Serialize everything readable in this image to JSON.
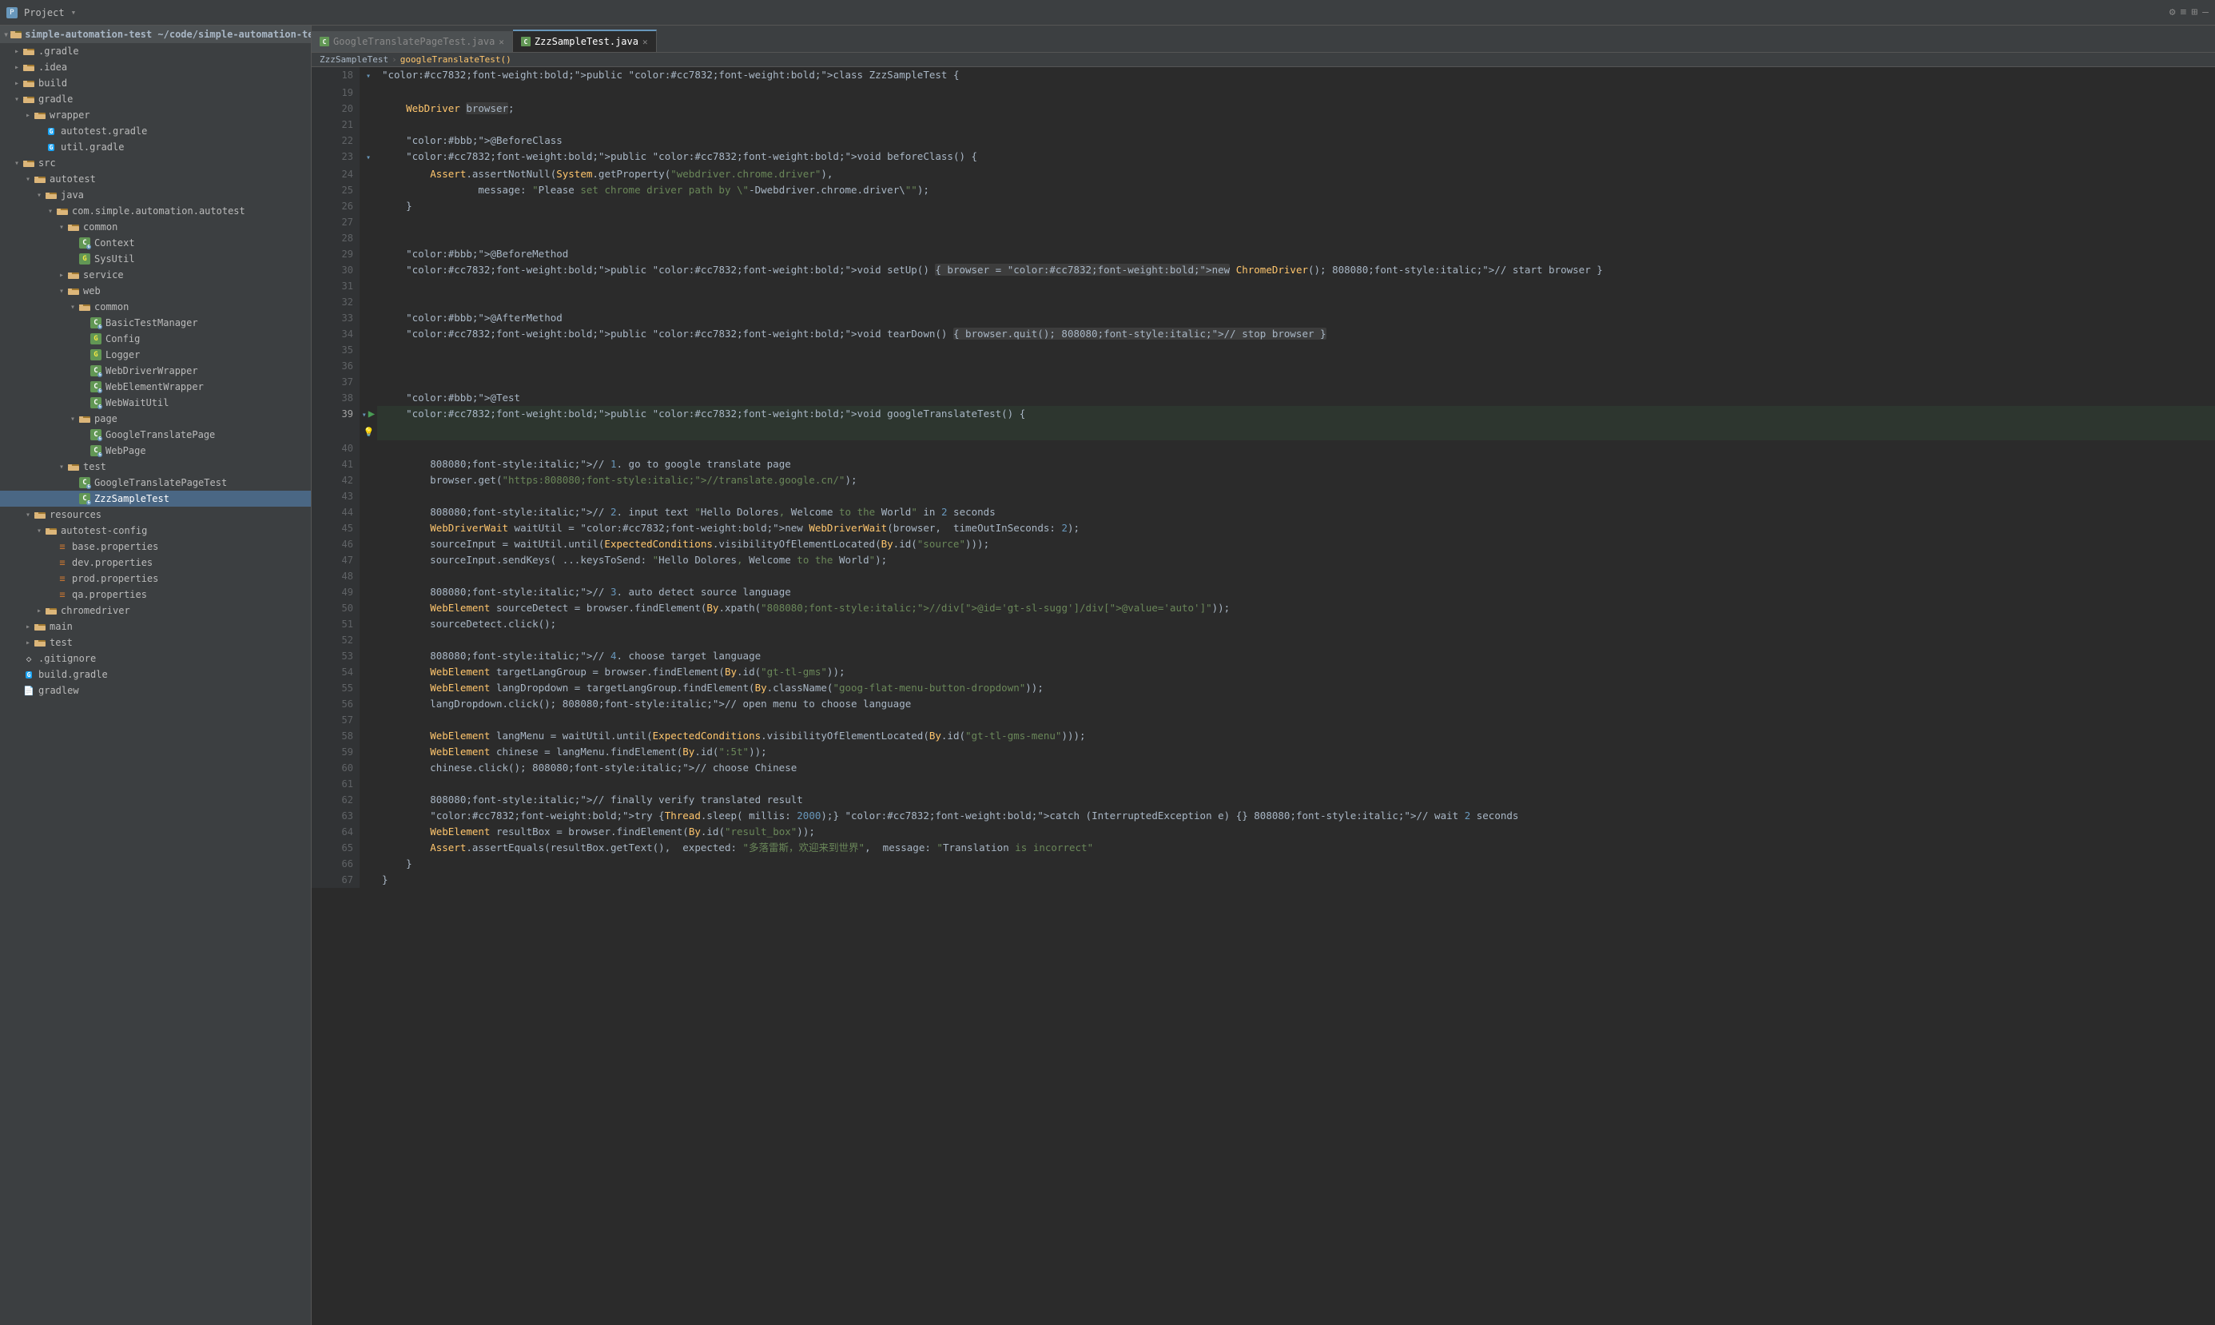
{
  "topbar": {
    "title": "Project",
    "dropdown_arrow": "▾"
  },
  "sidebar": {
    "header": "Project",
    "root": "simple-automation-test ~/code/simple-automation-te...",
    "items": [
      {
        "id": "gradle-folder",
        "label": ".gradle",
        "indent": 1,
        "type": "folder",
        "expanded": false
      },
      {
        "id": "idea-folder",
        "label": ".idea",
        "indent": 1,
        "type": "folder",
        "expanded": false
      },
      {
        "id": "build-folder",
        "label": "build",
        "indent": 1,
        "type": "folder",
        "expanded": false
      },
      {
        "id": "gradle-folder2",
        "label": "gradle",
        "indent": 1,
        "type": "folder",
        "expanded": true
      },
      {
        "id": "wrapper-folder",
        "label": "wrapper",
        "indent": 2,
        "type": "folder",
        "expanded": false
      },
      {
        "id": "autotest-gradle",
        "label": "autotest.gradle",
        "indent": 3,
        "type": "gradle"
      },
      {
        "id": "util-gradle",
        "label": "util.gradle",
        "indent": 3,
        "type": "gradle"
      },
      {
        "id": "src-folder",
        "label": "src",
        "indent": 1,
        "type": "folder",
        "expanded": true
      },
      {
        "id": "autotest-folder",
        "label": "autotest",
        "indent": 2,
        "type": "folder",
        "expanded": true
      },
      {
        "id": "java-folder",
        "label": "java",
        "indent": 3,
        "type": "folder",
        "expanded": true
      },
      {
        "id": "com-folder",
        "label": "com.simple.automation.autotest",
        "indent": 4,
        "type": "folder",
        "expanded": true
      },
      {
        "id": "common-folder",
        "label": "common",
        "indent": 5,
        "type": "folder",
        "expanded": true
      },
      {
        "id": "context-file",
        "label": "Context",
        "indent": 6,
        "type": "java-c"
      },
      {
        "id": "sysutil-file",
        "label": "SysUtil",
        "indent": 6,
        "type": "java-g"
      },
      {
        "id": "service-folder",
        "label": "service",
        "indent": 5,
        "type": "folder",
        "expanded": false
      },
      {
        "id": "web-folder",
        "label": "web",
        "indent": 5,
        "type": "folder",
        "expanded": true
      },
      {
        "id": "common-folder2",
        "label": "common",
        "indent": 6,
        "type": "folder",
        "expanded": true
      },
      {
        "id": "basictestmanager",
        "label": "BasicTestManager",
        "indent": 7,
        "type": "java-c"
      },
      {
        "id": "config-file",
        "label": "Config",
        "indent": 7,
        "type": "java-g"
      },
      {
        "id": "logger-file",
        "label": "Logger",
        "indent": 7,
        "type": "java-g"
      },
      {
        "id": "webdriverwrapper",
        "label": "WebDriverWrapper",
        "indent": 7,
        "type": "java-c"
      },
      {
        "id": "webelementwrapper",
        "label": "WebElementWrapper",
        "indent": 7,
        "type": "java-c"
      },
      {
        "id": "webwaitutil",
        "label": "WebWaitUtil",
        "indent": 7,
        "type": "java-c"
      },
      {
        "id": "page-folder",
        "label": "page",
        "indent": 6,
        "type": "folder",
        "expanded": true
      },
      {
        "id": "googletranslatepage",
        "label": "GoogleTranslatePage",
        "indent": 7,
        "type": "java-c"
      },
      {
        "id": "webpage-file",
        "label": "WebPage",
        "indent": 7,
        "type": "java-c"
      },
      {
        "id": "test-folder",
        "label": "test",
        "indent": 5,
        "type": "folder",
        "expanded": true
      },
      {
        "id": "googletranslatetest-file",
        "label": "GoogleTranslatePageTest",
        "indent": 6,
        "type": "java-c"
      },
      {
        "id": "zzzsampletest-file",
        "label": "ZzzSampleTest",
        "indent": 6,
        "type": "java-c",
        "selected": true
      },
      {
        "id": "resources-folder",
        "label": "resources",
        "indent": 2,
        "type": "folder",
        "expanded": true
      },
      {
        "id": "autotest-config-folder",
        "label": "autotest-config",
        "indent": 3,
        "type": "folder",
        "expanded": true
      },
      {
        "id": "base-properties",
        "label": "base.properties",
        "indent": 4,
        "type": "properties"
      },
      {
        "id": "dev-properties",
        "label": "dev.properties",
        "indent": 4,
        "type": "properties"
      },
      {
        "id": "prod-properties",
        "label": "prod.properties",
        "indent": 4,
        "type": "properties"
      },
      {
        "id": "qa-properties",
        "label": "qa.properties",
        "indent": 4,
        "type": "properties"
      },
      {
        "id": "chromedriver-folder",
        "label": "chromedriver",
        "indent": 3,
        "type": "folder",
        "expanded": false
      },
      {
        "id": "main-folder",
        "label": "main",
        "indent": 2,
        "type": "folder",
        "expanded": false
      },
      {
        "id": "test-folder2",
        "label": "test",
        "indent": 2,
        "type": "folder",
        "expanded": false
      },
      {
        "id": "gitignore",
        "label": ".gitignore",
        "indent": 1,
        "type": "git"
      },
      {
        "id": "build-gradle",
        "label": "build.gradle",
        "indent": 1,
        "type": "gradle"
      },
      {
        "id": "gradlew",
        "label": "gradlew",
        "indent": 1,
        "type": "file"
      }
    ]
  },
  "editor": {
    "tabs": [
      {
        "id": "tab-googletranslate",
        "label": "GoogleTranslatePageTest.java",
        "active": false
      },
      {
        "id": "tab-zzzsample",
        "label": "ZzzSampleTest.java",
        "active": true
      }
    ],
    "breadcrumb": [
      "ZzzSampleTest",
      "googleTranslateTest()"
    ],
    "lines": [
      {
        "num": 18,
        "code": "public class ZzzSampleTest {",
        "dec": "fold"
      },
      {
        "num": 19,
        "code": ""
      },
      {
        "num": 20,
        "code": "    WebDriver browser;"
      },
      {
        "num": 21,
        "code": ""
      },
      {
        "num": 22,
        "code": "    @BeforeClass"
      },
      {
        "num": 23,
        "code": "    public void beforeClass() {",
        "dec": "fold"
      },
      {
        "num": 24,
        "code": "        Assert.assertNotNull(System.getProperty(\"webdriver.chrome.driver\"),"
      },
      {
        "num": 25,
        "code": "                message: \"Please set chrome driver path by \\\"-Dwebdriver.chrome.driver\\\"\");"
      },
      {
        "num": 26,
        "code": "    }"
      },
      {
        "num": 27,
        "code": ""
      },
      {
        "num": 28,
        "code": ""
      },
      {
        "num": 29,
        "code": "    @BeforeMethod"
      },
      {
        "num": 30,
        "code": "    public void setUp() { browser = new ChromeDriver(); // start browser }"
      },
      {
        "num": 31,
        "code": ""
      },
      {
        "num": 32,
        "code": ""
      },
      {
        "num": 33,
        "code": "    @AfterMethod"
      },
      {
        "num": 34,
        "code": "    public void tearDown() { browser.quit(); // stop browser }"
      },
      {
        "num": 35,
        "code": ""
      },
      {
        "num": 36,
        "code": ""
      },
      {
        "num": 37,
        "code": ""
      },
      {
        "num": 38,
        "code": "    @Test"
      },
      {
        "num": 39,
        "code": "    public void googleTranslateTest() {",
        "dec": "run"
      },
      {
        "num": 40,
        "code": ""
      },
      {
        "num": 41,
        "code": "        // 1. go to google translate page"
      },
      {
        "num": 42,
        "code": "        browser.get(\"https://translate.google.cn/\");"
      },
      {
        "num": 43,
        "code": ""
      },
      {
        "num": 44,
        "code": "        // 2. input text \"Hello Dolores, Welcome to the World\" in 2 seconds"
      },
      {
        "num": 45,
        "code": "        WebDriverWait waitUtil = new WebDriverWait(browser,  timeOutInSeconds: 2);"
      },
      {
        "num": 46,
        "code": "        sourceInput = waitUtil.until(ExpectedConditions.visibilityOfElementLocated(By.id(\"source\")));"
      },
      {
        "num": 47,
        "code": "        sourceInput.sendKeys( ...keysToSend: \"Hello Dolores, Welcome to the World\");"
      },
      {
        "num": 48,
        "code": ""
      },
      {
        "num": 49,
        "code": "        // 3. auto detect source language"
      },
      {
        "num": 50,
        "code": "        WebElement sourceDetect = browser.findElement(By.xpath(\"//div[@id='gt-sl-sugg']/div[@value='auto']\"));"
      },
      {
        "num": 51,
        "code": "        sourceDetect.click();"
      },
      {
        "num": 52,
        "code": ""
      },
      {
        "num": 53,
        "code": "        // 4. choose target language"
      },
      {
        "num": 54,
        "code": "        WebElement targetLangGroup = browser.findElement(By.id(\"gt-tl-gms\"));"
      },
      {
        "num": 55,
        "code": "        WebElement langDropdown = targetLangGroup.findElement(By.className(\"goog-flat-menu-button-dropdown\"));"
      },
      {
        "num": 56,
        "code": "        langDropdown.click(); // open menu to choose language"
      },
      {
        "num": 57,
        "code": ""
      },
      {
        "num": 58,
        "code": "        WebElement langMenu = waitUtil.until(ExpectedConditions.visibilityOfElementLocated(By.id(\"gt-tl-gms-menu\")));"
      },
      {
        "num": 59,
        "code": "        WebElement chinese = langMenu.findElement(By.id(\":5t\"));"
      },
      {
        "num": 60,
        "code": "        chinese.click(); // choose Chinese"
      },
      {
        "num": 61,
        "code": ""
      },
      {
        "num": 62,
        "code": "        // finally verify translated result"
      },
      {
        "num": 63,
        "code": "        try {Thread.sleep( millis: 2000);} catch (InterruptedException e) {} // wait 2 seconds"
      },
      {
        "num": 64,
        "code": "        WebElement resultBox = browser.findElement(By.id(\"result_box\"));"
      },
      {
        "num": 65,
        "code": "        Assert.assertEquals(resultBox.getText(),  expected: \"多落雷斯，欢迎来到世界\",  message: \"Translation is incorrect\""
      },
      {
        "num": 66,
        "code": "    }"
      },
      {
        "num": 67,
        "code": "}"
      }
    ]
  }
}
